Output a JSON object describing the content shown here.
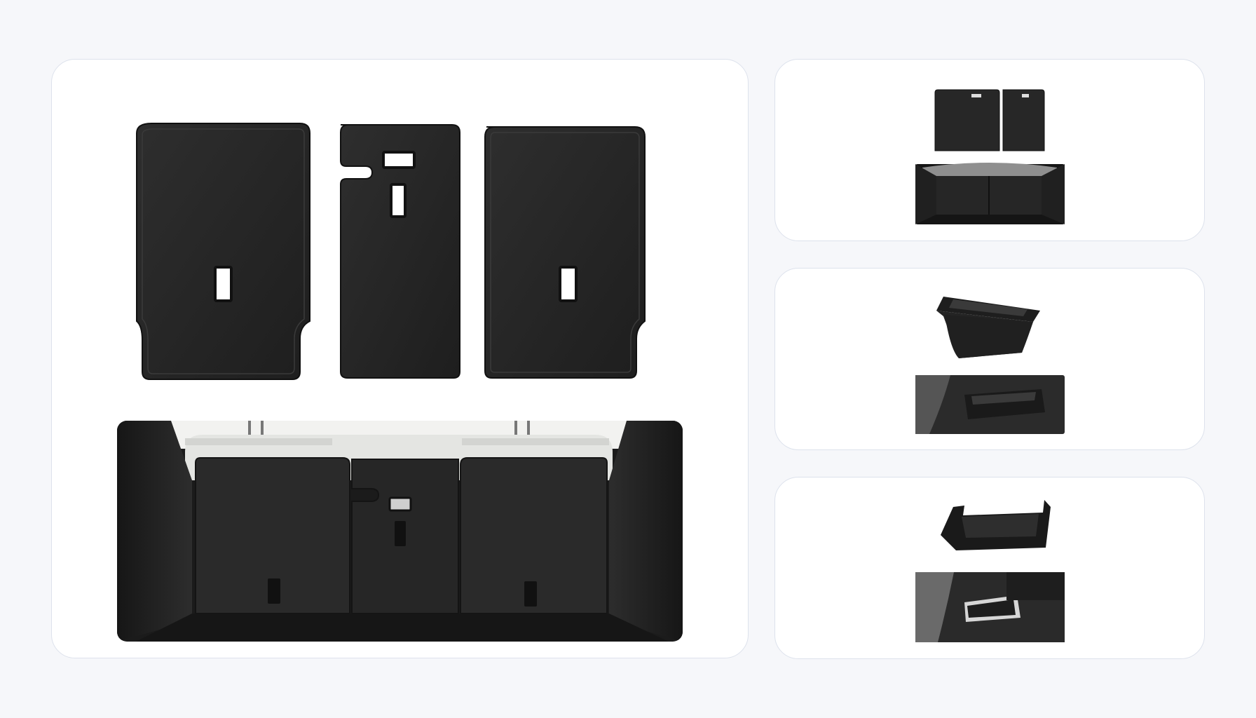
{
  "gallery": {
    "main": {
      "product": "three-piece-seat-back-mat-set",
      "scene": "installed-in-trunk"
    },
    "thumbnails": [
      {
        "product": "split-seat-back-mats",
        "scene": "trunk-view"
      },
      {
        "product": "under-seat-storage-tray",
        "scene": "under-seat-installed"
      },
      {
        "product": "under-seat-storage-box",
        "scene": "rear-footwell-installed"
      }
    ]
  },
  "colors": {
    "page_background": "#f6f7fa",
    "card_background": "#ffffff",
    "card_border": "#dde2ec",
    "mat": "#262626",
    "cutout": "#ffffff",
    "upholstery": "#e4e5e2",
    "carpet": "#1f1f1f"
  }
}
